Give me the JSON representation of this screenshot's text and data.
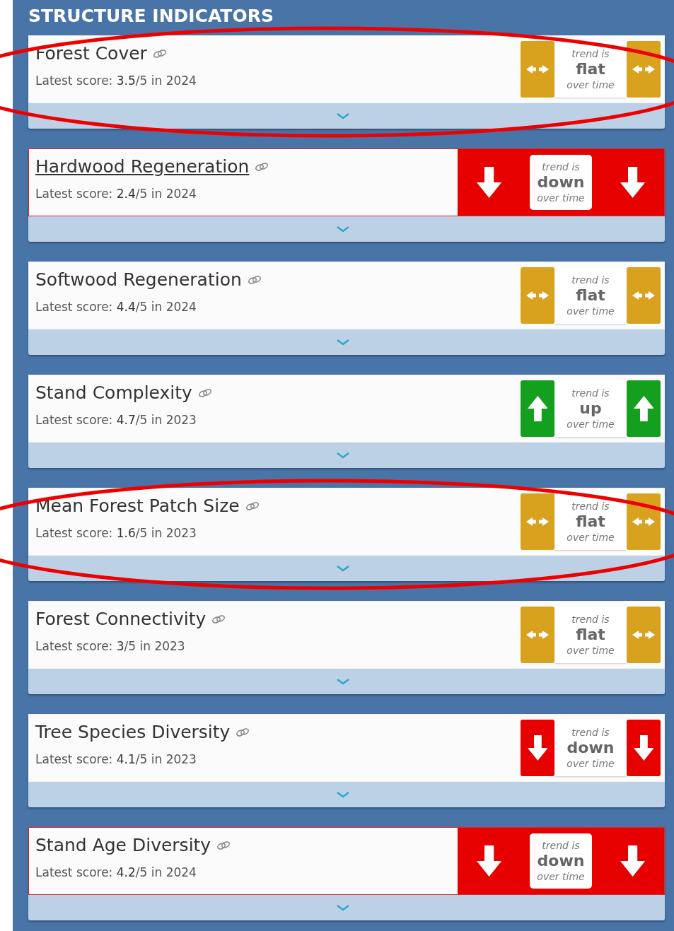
{
  "section_title": "STRUCTURE INDICATORS",
  "cards": [
    {
      "title": "Forest Cover",
      "score": "Latest score: **3.5**/5 in 2024",
      "alert": false,
      "hovered": false,
      "circled": true,
      "trend": {
        "kind": "flat",
        "above": "trend is",
        "word": "flat",
        "below": "over time"
      }
    },
    {
      "title": "Hardwood Regeneration",
      "score": "Latest score: **2.4**/5 in 2024",
      "alert": true,
      "hovered": true,
      "circled": false,
      "trend": {
        "kind": "down",
        "above": "trend is",
        "word": "down",
        "below": "over time"
      }
    },
    {
      "title": "Softwood Regeneration",
      "score": "Latest score: **4.4**/5 in 2024",
      "alert": false,
      "hovered": false,
      "circled": false,
      "trend": {
        "kind": "flat",
        "above": "trend is",
        "word": "flat",
        "below": "over time"
      }
    },
    {
      "title": "Stand Complexity",
      "score": "Latest score: **4.7**/5 in 2023",
      "alert": false,
      "hovered": false,
      "circled": false,
      "trend": {
        "kind": "up",
        "above": "trend is",
        "word": "up",
        "below": "over time"
      }
    },
    {
      "title": "Mean Forest Patch Size",
      "score": "Latest score: **1.6**/5 in 2023",
      "alert": false,
      "hovered": false,
      "circled": true,
      "trend": {
        "kind": "flat",
        "above": "trend is",
        "word": "flat",
        "below": "over time"
      }
    },
    {
      "title": "Forest Connectivity",
      "score": "Latest score: **3**/5 in 2023",
      "alert": false,
      "hovered": false,
      "circled": false,
      "trend": {
        "kind": "flat",
        "above": "trend is",
        "word": "flat",
        "below": "over time"
      }
    },
    {
      "title": "Tree Species Diversity",
      "score": "Latest score: **4.1**/5 in 2023",
      "alert": false,
      "hovered": false,
      "circled": false,
      "trend": {
        "kind": "down",
        "above": "trend is",
        "word": "down",
        "below": "over time"
      }
    },
    {
      "title": "Stand Age Diversity",
      "score": "Latest score: **4.2**/5 in 2024",
      "alert": true,
      "hovered": false,
      "circled": false,
      "trend": {
        "kind": "down",
        "above": "trend is",
        "word": "down",
        "below": "over time"
      }
    }
  ]
}
